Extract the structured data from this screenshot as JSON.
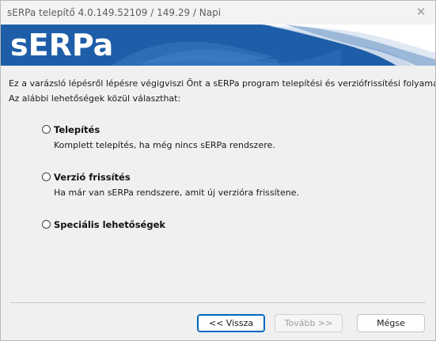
{
  "window": {
    "title": "sERPa telepítő 4.0.149.52109 / 149.29 / Napi",
    "close_glyph": "✕"
  },
  "banner": {
    "logo_text": "sERPa",
    "background_color": "#1e5ea8"
  },
  "intro": {
    "line1": "Ez a varázsló lépésről lépésre végigviszi Önt a sERPa program telepítési és verziófrissítési folyamatán.",
    "line2": "Az alábbi lehetőségek közül választhat:"
  },
  "options": [
    {
      "label": "Telepítés",
      "description": "Komplett telepítés, ha még nincs sERPa rendszere.",
      "selected": false
    },
    {
      "label": "Verzió frissítés",
      "description": "Ha már van sERPa rendszere, amit új verzióra frissítene.",
      "selected": false
    },
    {
      "label": "Speciális lehetőségek",
      "description": "",
      "selected": false
    }
  ],
  "buttons": {
    "back": "<< Vissza",
    "next": "Tovább >>",
    "cancel": "Mégse"
  }
}
